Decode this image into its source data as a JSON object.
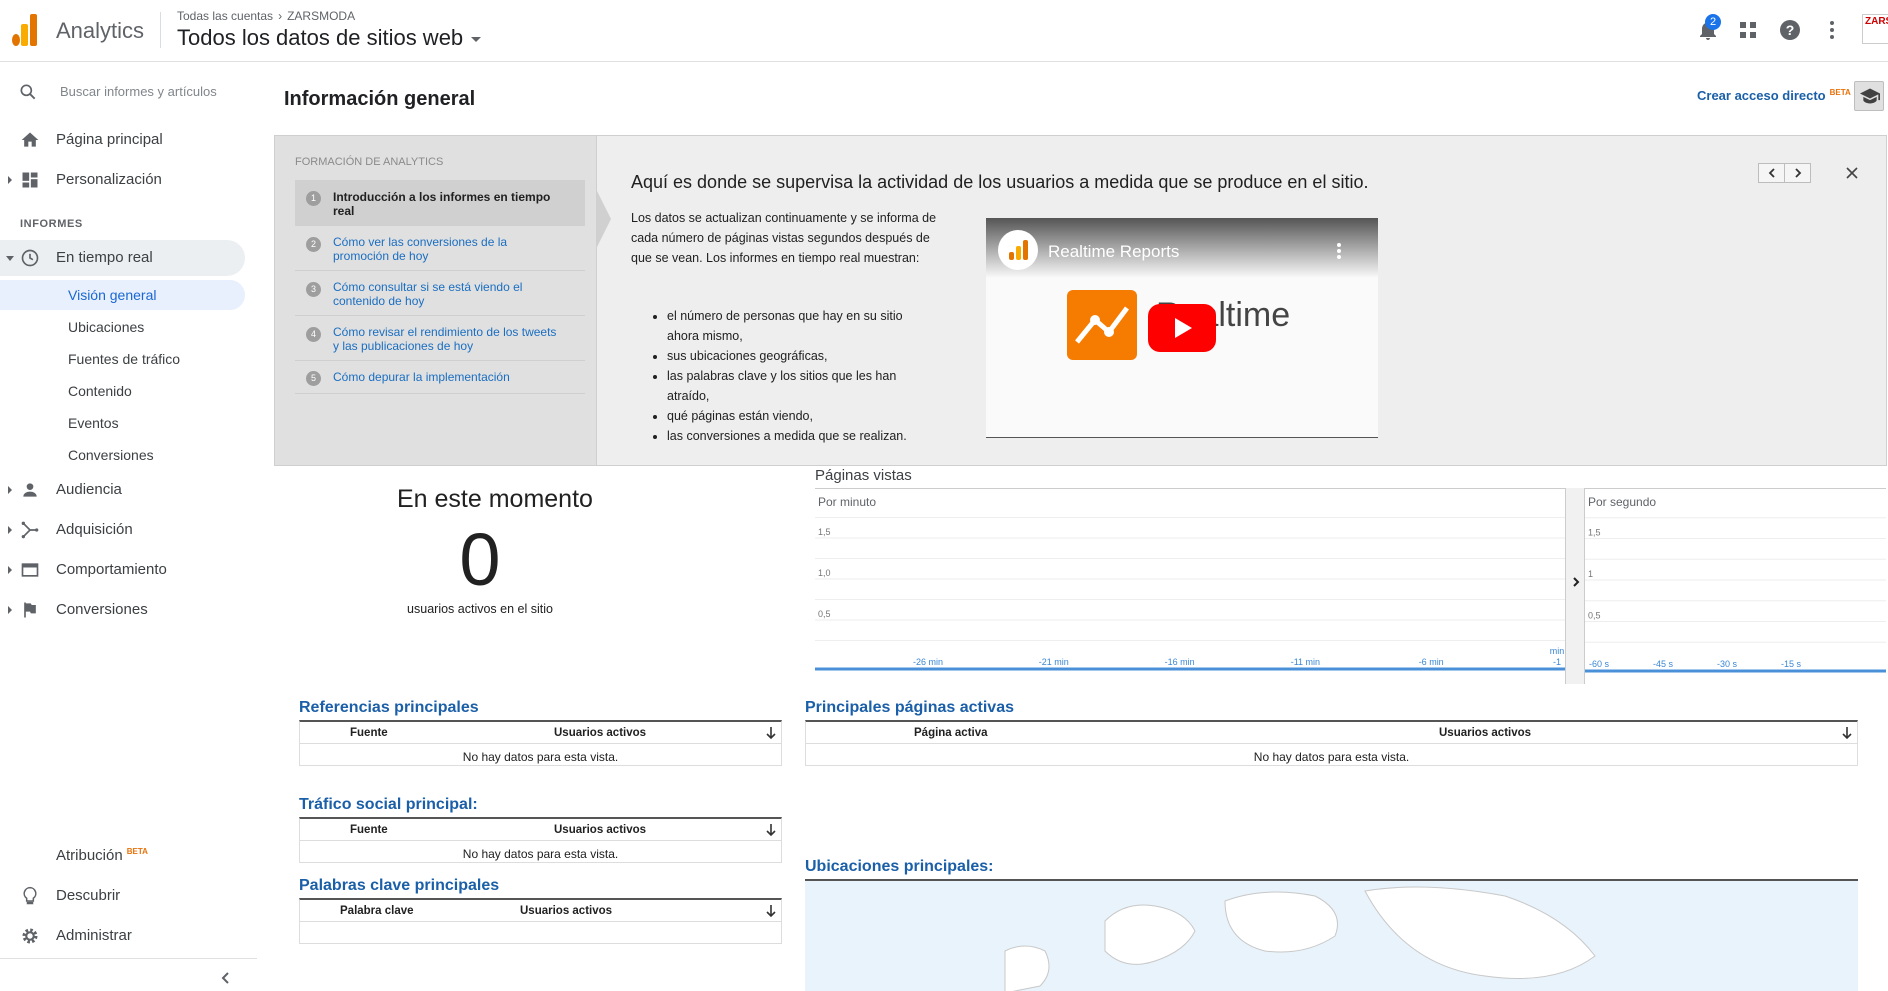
{
  "app": {
    "name": "Analytics",
    "breadcrumb": [
      "Todas las cuentas",
      "ZARSMODA"
    ],
    "view_selector": "Todos los datos de sitios web",
    "notification_count": "2",
    "avatar_text": "ZARS"
  },
  "sidebar": {
    "search_placeholder": "Buscar informes y artículos",
    "home": "Página principal",
    "custom": "Personalización",
    "section_label": "INFORMES",
    "realtime": "En tiempo real",
    "realtime_items": [
      "Visión general",
      "Ubicaciones",
      "Fuentes de tráfico",
      "Contenido",
      "Eventos",
      "Conversiones"
    ],
    "audience": "Audiencia",
    "acquisition": "Adquisición",
    "behavior": "Comportamiento",
    "conversions": "Conversiones",
    "attribution": "Atribución",
    "beta": "BETA",
    "discover": "Descubrir",
    "admin": "Administrar"
  },
  "main": {
    "page_title": "Información general",
    "shortcut": "Crear acceso directo",
    "shortcut_beta": "BETA"
  },
  "training": {
    "header": "FORMACIÓN DE ANALYTICS",
    "steps": [
      {
        "num": "1",
        "text": "Introducción a los informes en tiempo real"
      },
      {
        "num": "2",
        "text": "Cómo ver las conversiones de la promoción de hoy"
      },
      {
        "num": "3",
        "text": "Cómo consultar si se está viendo el contenido de hoy"
      },
      {
        "num": "4",
        "text": "Cómo revisar el rendimiento de los tweets y las publicaciones de hoy"
      },
      {
        "num": "5",
        "text": "Cómo depurar la implementación"
      }
    ],
    "heading": "Aquí es donde se supervisa la actividad de los usuarios a medida que se produce en el sitio.",
    "body": "Los datos se actualizan continuamente y se informa de cada número de páginas vistas segundos después de que se vean. Los informes en tiempo real muestran:",
    "bullets": [
      "el número de personas que hay en su sitio ahora mismo,",
      "sus ubicaciones geográficas,",
      "las palabras clave y los sitios que les han atraído,",
      "qué páginas están viendo,",
      "las conversiones a medida que se realizan."
    ],
    "video_title": "Realtime Reports",
    "video_word": "Realtime"
  },
  "now": {
    "title": "En este momento",
    "value": "0",
    "label": "usuarios activos en el sitio"
  },
  "pageviews": {
    "title": "Páginas vistas",
    "per_minute": "Por minuto",
    "per_second": "Por segundo"
  },
  "chart_data": [
    {
      "type": "bar",
      "title": "Por minuto",
      "y_ticks": [
        "0,5",
        "1,0",
        "1,5"
      ],
      "ylim": [
        0,
        2
      ],
      "x_ticks": [
        "-26 min",
        "-21 min",
        "-16 min",
        "-11 min",
        "-6 min",
        "-1"
      ],
      "x_unit_label": "min",
      "values": []
    },
    {
      "type": "bar",
      "title": "Por segundo",
      "y_ticks": [
        "0,5",
        "1",
        "1,5"
      ],
      "ylim": [
        0,
        2
      ],
      "x_ticks": [
        "-60 s",
        "-45 s",
        "-30 s",
        "-15 s"
      ],
      "values": []
    }
  ],
  "tables": {
    "referrals": {
      "title": "Referencias principales",
      "col1": "Fuente",
      "col2": "Usuarios activos",
      "empty": "No hay datos para esta vista."
    },
    "pages": {
      "title": "Principales páginas activas",
      "col1": "Página activa",
      "col2": "Usuarios activos",
      "empty": "No hay datos para esta vista."
    },
    "social": {
      "title": "Tráfico social principal:",
      "col1": "Fuente",
      "col2": "Usuarios activos",
      "empty": "No hay datos para esta vista."
    },
    "locations": {
      "title": "Ubicaciones principales:"
    },
    "keywords": {
      "title": "Palabras clave principales",
      "col1": "Palabra clave",
      "col2": "Usuarios activos"
    }
  },
  "colors": {
    "accent": "#1a73e8",
    "link": "#1a5fa8",
    "logo_orange": "#f9ab00",
    "logo_dark": "#e37400"
  }
}
